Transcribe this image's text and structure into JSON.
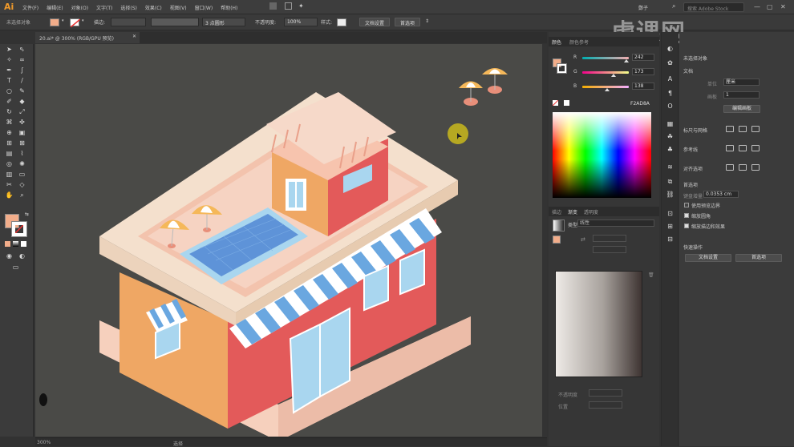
{
  "app": {
    "logo": "Ai",
    "user": "鄭子",
    "search_placeholder": "搜索 Adobe Stock"
  },
  "menu": [
    "文件(F)",
    "编辑(E)",
    "对象(O)",
    "文字(T)",
    "选择(S)",
    "效果(C)",
    "视图(V)",
    "窗口(W)",
    "帮助(H)"
  ],
  "control": {
    "selection": "未选择对象",
    "stroke_label": "描边:",
    "stroke_weight": "3 点圆形",
    "opacity_label": "不透明度:",
    "opacity": "100%",
    "style_label": "样式:",
    "doc_setup": "文档设置",
    "prefs": "首选项"
  },
  "document": {
    "tab": "20.ai* @ 300% (RGB/GPU 预览)",
    "zoom": "300%",
    "status": "选择"
  },
  "color_panel": {
    "tabs": [
      "颜色",
      "颜色参考"
    ],
    "r_label": "R",
    "g_label": "G",
    "b_label": "B",
    "r": "242",
    "g": "173",
    "b": "138",
    "r_frac": 0.95,
    "g_frac": 0.68,
    "b_frac": 0.54,
    "hex": "F2AD8A"
  },
  "gradient_panel": {
    "tabs": [
      "描边",
      "渐变",
      "透明度"
    ],
    "type_label": "类型",
    "type": "线性",
    "opacity_label": "不透明度",
    "position_label": "位置"
  },
  "properties": {
    "header": "未选择对象",
    "doc_section": "文档",
    "units_label": "单位",
    "units": "厘米",
    "artboard_label": "画板",
    "artboard": "1",
    "edit_artboard": "编辑画板",
    "rulers_grids": "标尺与网格",
    "guides": "参考线",
    "align_to": "对齐选项",
    "prefs_section": "首选项",
    "keyboard_inc_label": "键盘增量",
    "keyboard_inc": "0.0353 cm",
    "preview_bounds": "使用预览边界",
    "scale_corners": "缩放圆角",
    "scale_strokes": "缩放描边和效果",
    "quick_actions": "快速操作",
    "doc_setup_btn": "文档设置",
    "prefs_btn": "首选项"
  },
  "watermark": "虎课网",
  "colors": {
    "fill": "#F2AD8A",
    "accent": "#f19a2a"
  }
}
